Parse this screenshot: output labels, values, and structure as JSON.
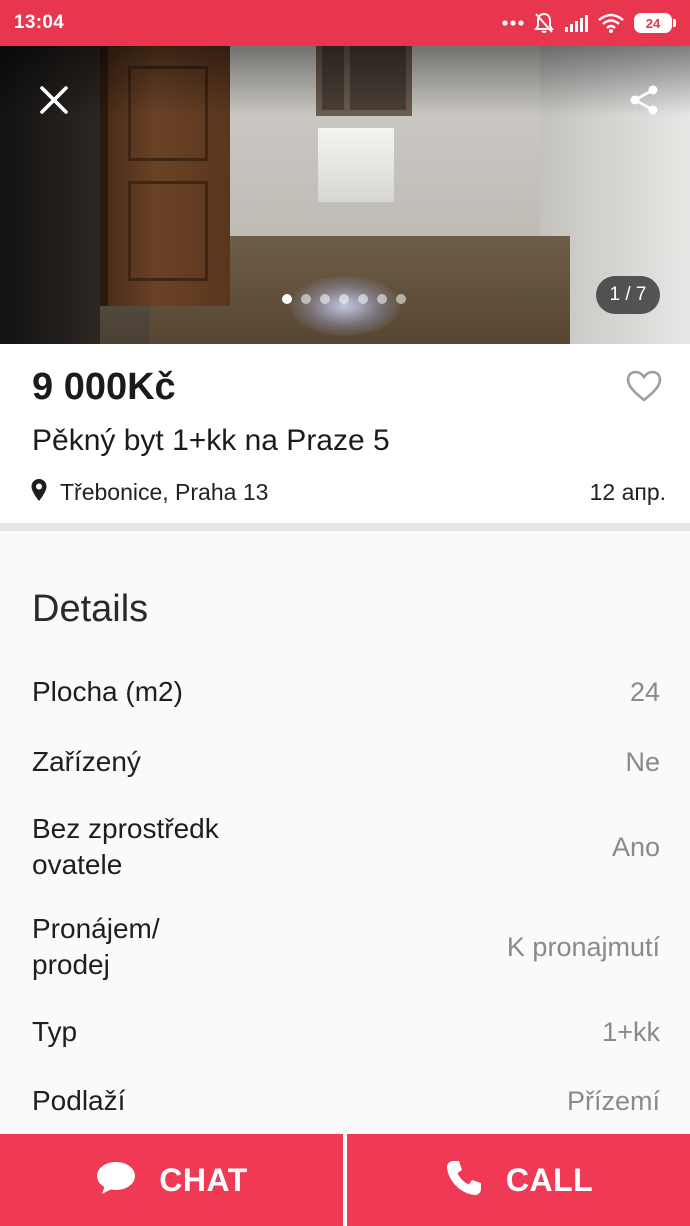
{
  "status_bar": {
    "time": "13:04",
    "battery_level": "24",
    "icons": [
      "more-dots-icon",
      "mute-bell-icon",
      "signal-icon",
      "wifi-icon",
      "battery-icon"
    ],
    "background_color": "#e8364f"
  },
  "gallery": {
    "counter": "1 / 7",
    "total_images": 7,
    "current_index": 1,
    "icons": {
      "close": "close-icon",
      "share": "share-icon"
    }
  },
  "listing": {
    "price": "9 000Kč",
    "title": "Pěkný byt 1+kk na Praze 5",
    "location": "Třebonice, Praha 13",
    "date": "12 апр.",
    "favorite_icon": "heart-outline-icon"
  },
  "details": {
    "heading": "Details",
    "rows": [
      {
        "label": "Plocha (m2)",
        "value": "24"
      },
      {
        "label": "Zařízený",
        "value": "Ne"
      },
      {
        "label": "Bez zprostředk ovatele",
        "value": "Ano"
      },
      {
        "label": "Pronájem/ prodej",
        "value": "K pronajmutí"
      },
      {
        "label": "Typ",
        "value": "1+kk"
      },
      {
        "label": "Podlaží",
        "value": "Přízemí"
      }
    ]
  },
  "actions": {
    "chat_label": "CHAT",
    "call_label": "CALL",
    "accent_color": "#f03a55"
  }
}
